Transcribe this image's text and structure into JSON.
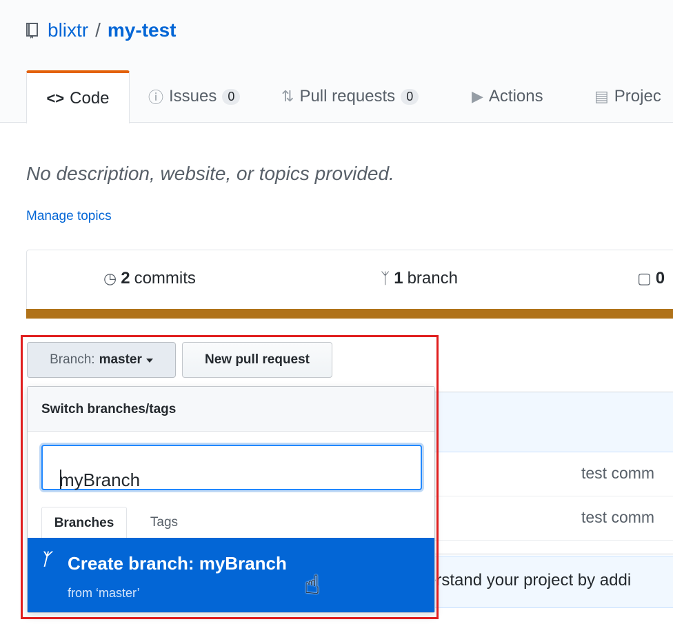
{
  "repo": {
    "owner": "blixtr",
    "separator": "/",
    "name": "my-test"
  },
  "tabs": [
    {
      "label": "Code",
      "icon": "code-icon"
    },
    {
      "label": "Issues",
      "count": "0",
      "icon": "issue-icon"
    },
    {
      "label": "Pull requests",
      "count": "0",
      "icon": "pull-request-icon"
    },
    {
      "label": "Actions",
      "icon": "play-icon"
    },
    {
      "label": "Projec",
      "icon": "project-icon"
    }
  ],
  "about": {
    "description": "No description, website, or topics provided.",
    "manage_topics": "Manage topics"
  },
  "summary": {
    "commits": {
      "count": "2",
      "label": "commits"
    },
    "branches": {
      "count": "1",
      "label": "branch"
    },
    "packages": {
      "count": "0"
    },
    "language_color": "#b07219"
  },
  "toolbar": {
    "branch_prefix": "Branch:",
    "branch_name": "master",
    "new_pr": "New pull request"
  },
  "dropdown": {
    "title": "Switch branches/tags",
    "filter_value": "myBranch",
    "tab_branches": "Branches",
    "tab_tags": "Tags",
    "create_label": "Create branch: myBranch",
    "create_from": "from ‘master’"
  },
  "files": [
    {
      "commit_message": "test comm"
    },
    {
      "commit_message": "test comm"
    }
  ],
  "readme_prompt": "erstand your project by addi",
  "colors": {
    "accent": "#0366d6",
    "highlight": "#e01e1e",
    "tab_active": "#e36209"
  }
}
